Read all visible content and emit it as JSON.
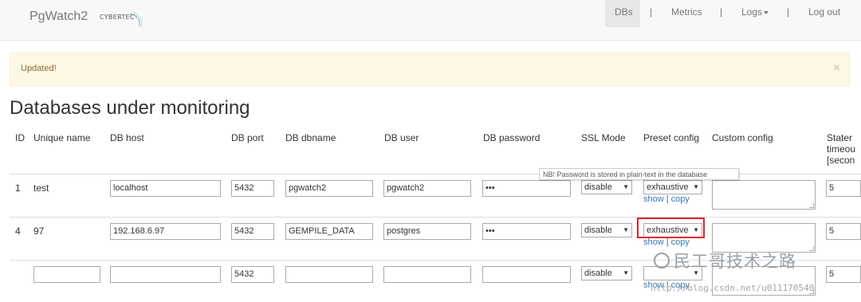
{
  "nav": {
    "brand": "PgWatch2",
    "logo_text": "CYBERTEC",
    "items": [
      {
        "label": "DBs",
        "active": true
      },
      {
        "label": "Metrics"
      },
      {
        "label": "Logs"
      },
      {
        "label": "Log out"
      }
    ],
    "separator": "|"
  },
  "alert": {
    "message": "Updated!",
    "close": "×"
  },
  "page_title": "Databases under monitoring",
  "table": {
    "headers": [
      "ID",
      "Unique name",
      "DB host",
      "DB port",
      "DB dbname",
      "DB user",
      "DB password",
      "SSL Mode",
      "Preset config",
      "Custom config",
      "Stater timeou [secon"
    ],
    "rows": [
      {
        "id": "1",
        "unique_name": "test",
        "host": "localhost",
        "port": "5432",
        "dbname": "pgwatch2",
        "user": "pgwatch2",
        "password": "•••",
        "ssl": "disable",
        "preset": "exhaustive",
        "timeout": "5"
      },
      {
        "id": "4",
        "unique_name": "97",
        "host": "192.168.6.97",
        "port": "5432",
        "dbname": "GEMPILE_DATA",
        "user": "postgres",
        "password": "•••",
        "ssl": "disable",
        "preset": "exhaustive",
        "timeout": "5"
      },
      {
        "id": "",
        "unique_name": "",
        "host": "",
        "port": "5432",
        "dbname": "",
        "user": "",
        "password": "",
        "ssl": "disable",
        "preset": "",
        "timeout": "5"
      }
    ],
    "show_label": "show",
    "copy_label": "copy",
    "link_sep": "|"
  },
  "tooltip": "NB! Password is stored in plain-text in the database",
  "watermark": {
    "text": "民工哥技术之路",
    "url": "http://blog.csdn.net/u011170540"
  },
  "colors": {
    "alert_bg": "#fcf8e3",
    "alert_text": "#8a6d3b",
    "link": "#337ab7",
    "highlight": "#e0202a"
  }
}
